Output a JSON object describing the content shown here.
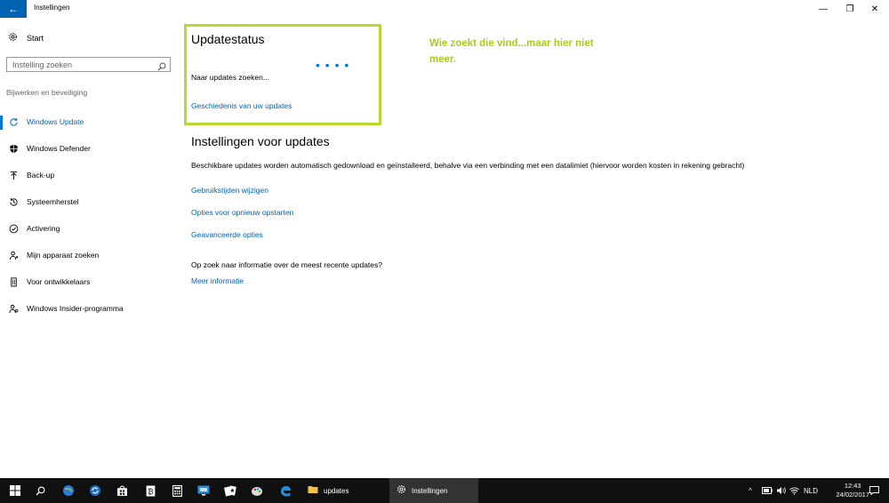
{
  "window": {
    "title": "Instellingen",
    "back_glyph": "←",
    "minimize_glyph": "—",
    "maximize_glyph": "❐",
    "close_glyph": "✕"
  },
  "sidebar": {
    "start_label": "Start",
    "search_placeholder": "Instelling zoeken",
    "section_label": "Bijwerken en beveiliging",
    "items": [
      {
        "label": "Windows Update",
        "icon": "refresh-icon",
        "active": true
      },
      {
        "label": "Windows Defender",
        "icon": "shield-icon"
      },
      {
        "label": "Back-up",
        "icon": "upload-arrow-icon"
      },
      {
        "label": "Systeemherstel",
        "icon": "history-icon"
      },
      {
        "label": "Activering",
        "icon": "check-circle-icon"
      },
      {
        "label": "Mijn apparaat zoeken",
        "icon": "person-pin-icon"
      },
      {
        "label": "Voor ontwikkelaars",
        "icon": "developer-icon"
      },
      {
        "label": "Windows Insider-programma",
        "icon": "insider-icon"
      }
    ]
  },
  "main": {
    "status_heading": "Updatestatus",
    "status_text": "Naar updates zoeken...",
    "progress_dots": "• • •   •",
    "history_link": "Geschiedenis van uw updates",
    "annotation": "Wie zoekt die vind...maar hier niet meer.",
    "settings_heading": "Instellingen voor updates",
    "settings_desc": "Beschikbare updates worden automatisch gedownload en geïnstalleerd, behalve via een verbinding met een datalimiet (hiervoor worden kosten in rekening gebracht)",
    "links": [
      "Gebruikstijden wijzigen",
      "Opties voor opnieuw opstarten",
      "Geavanceerde opties"
    ],
    "info_question": "Op zoek naar informatie over de meest recente updates?",
    "more_info_link": "Meer informatie"
  },
  "taskbar": {
    "apps": [
      {
        "label": "updates",
        "icon": "folder-icon"
      },
      {
        "label": "Instellingen",
        "icon": "gear-icon"
      }
    ],
    "tray": {
      "chevron": "^",
      "language": "NLD"
    },
    "clock": {
      "time": "12:43",
      "date": "24/02/2017"
    }
  },
  "colors": {
    "accent": "#0078d7",
    "link": "#0063b1",
    "highlight": "#b5d832",
    "annotation": "#a6ce1f",
    "taskbar": "#101010"
  }
}
